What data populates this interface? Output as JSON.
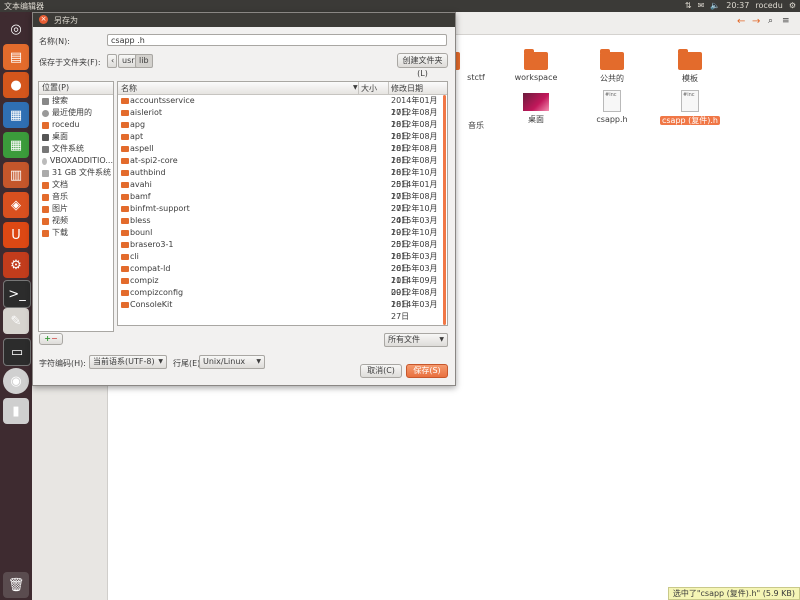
{
  "top_panel": {
    "app_title": "文本编辑器",
    "time": "20:37",
    "user": "rocedu"
  },
  "file_manager": {
    "items": [
      {
        "label": "stctf",
        "kind": "folder"
      },
      {
        "label": "workspace",
        "kind": "folder"
      },
      {
        "label": "公共的",
        "kind": "folder-shared"
      },
      {
        "label": "模板",
        "kind": "folder-template"
      },
      {
        "label": "音乐",
        "kind": "folder"
      },
      {
        "label": "桌面",
        "kind": "image"
      },
      {
        "label": "csapp.h",
        "kind": "file"
      },
      {
        "label": "csapp (复件).h",
        "kind": "file",
        "selected": true
      }
    ],
    "status": "选中了\"csapp (复件).h\" (5.9 KB)"
  },
  "dialog": {
    "title": "另存为",
    "name_label": "名称(N):",
    "name_value": "csapp .h",
    "save_in_label": "保存于文件夹(F):",
    "path": [
      "usr",
      "lib"
    ],
    "create_folder_button": "创建文件夹(L)",
    "places_header": "位置(P)",
    "places": [
      {
        "label": "搜索",
        "icon": "search-icon"
      },
      {
        "label": "最近使用的",
        "icon": "clock-icon"
      },
      {
        "label": "rocedu",
        "icon": "home-icon"
      },
      {
        "label": "桌面",
        "icon": "desktop-icon"
      },
      {
        "label": "文件系统",
        "icon": "harddisk-icon"
      },
      {
        "label": "VBOXADDITIO...",
        "icon": "disc-icon"
      },
      {
        "label": "31 GB 文件系统",
        "icon": "usb-drive-icon"
      },
      {
        "label": "文档",
        "icon": "folder-icon"
      },
      {
        "label": "音乐",
        "icon": "music-folder-icon"
      },
      {
        "label": "图片",
        "icon": "pictures-folder-icon"
      },
      {
        "label": "视频",
        "icon": "video-folder-icon"
      },
      {
        "label": "下载",
        "icon": "download-folder-icon"
      }
    ],
    "columns": {
      "name": "名称",
      "size": "大小",
      "modified": "修改日期"
    },
    "files": [
      {
        "name": "accountsservice",
        "date": "2014年01月17日"
      },
      {
        "name": "aisleriot",
        "date": "2012年08月18日"
      },
      {
        "name": "apg",
        "date": "2012年08月18日"
      },
      {
        "name": "apt",
        "date": "2012年08月18日"
      },
      {
        "name": "aspell",
        "date": "2012年08月18日"
      },
      {
        "name": "at-spi2-core",
        "date": "2012年08月18日"
      },
      {
        "name": "authbind",
        "date": "2012年10月25日"
      },
      {
        "name": "avahi",
        "date": "2014年01月17日"
      },
      {
        "name": "bamf",
        "date": "2013年08月27日"
      },
      {
        "name": "binfmt-support",
        "date": "2012年10月24日"
      },
      {
        "name": "bless",
        "date": "2015年03月19日"
      },
      {
        "name": "bounl",
        "date": "2012年10月25日"
      },
      {
        "name": "brasero3-1",
        "date": "2012年08月18日"
      },
      {
        "name": "cli",
        "date": "2015年03月26日"
      },
      {
        "name": "compat-ld",
        "date": "2015年03月11日"
      },
      {
        "name": "compiz",
        "date": "2014年09月09日"
      },
      {
        "name": "compizconfig",
        "date": "2012年08月18日"
      },
      {
        "name": "ConsoleKit",
        "date": "2014年03月27日"
      }
    ],
    "filter_select": "所有文件",
    "encoding_label": "字符编码(H):",
    "encoding_value": "当前语系(UTF-8)",
    "line_end_label": "行尾(E):",
    "line_end_value": "Unix/Linux",
    "cancel_button": "取消(C)",
    "save_button": "保存(S)"
  },
  "colors": {
    "accent": "#f07746",
    "launcher_bg": "#3e2b30",
    "panel_bg": "#3b3a37"
  }
}
